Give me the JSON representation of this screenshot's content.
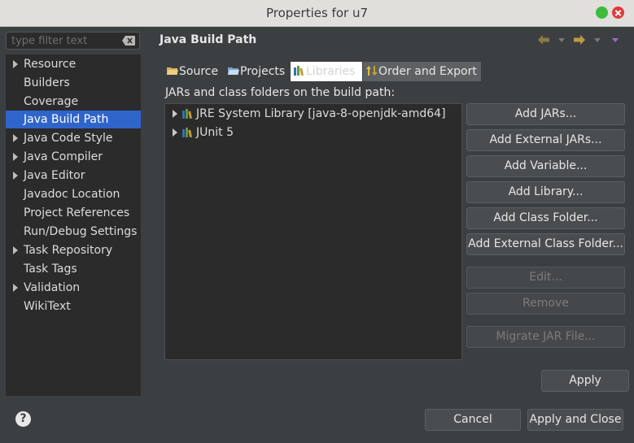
{
  "window": {
    "title": "Properties for u7"
  },
  "filter": {
    "placeholder": "type filter text"
  },
  "nav": {
    "items": [
      {
        "label": "Resource",
        "expandable": true
      },
      {
        "label": "Builders",
        "expandable": false
      },
      {
        "label": "Coverage",
        "expandable": false
      },
      {
        "label": "Java Build Path",
        "expandable": false,
        "selected": true
      },
      {
        "label": "Java Code Style",
        "expandable": true
      },
      {
        "label": "Java Compiler",
        "expandable": true
      },
      {
        "label": "Java Editor",
        "expandable": true
      },
      {
        "label": "Javadoc Location",
        "expandable": false
      },
      {
        "label": "Project References",
        "expandable": false
      },
      {
        "label": "Run/Debug Settings",
        "expandable": false
      },
      {
        "label": "Task Repository",
        "expandable": true
      },
      {
        "label": "Task Tags",
        "expandable": false
      },
      {
        "label": "Validation",
        "expandable": true
      },
      {
        "label": "WikiText",
        "expandable": false
      }
    ]
  },
  "page": {
    "title": "Java Build Path"
  },
  "tabs": [
    {
      "label": "Source",
      "icon": "source-folder-icon"
    },
    {
      "label": "Projects",
      "icon": "projects-icon"
    },
    {
      "label": "Libraries",
      "icon": "libraries-icon",
      "active": true
    },
    {
      "label": "Order and Export",
      "icon": "order-export-icon"
    }
  ],
  "libraries": {
    "section_label": "JARs and class folders on the build path:",
    "entries": [
      {
        "label": "JRE System Library [java-8-openjdk-amd64]"
      },
      {
        "label": "JUnit 5"
      }
    ]
  },
  "buttons": {
    "add_jars": "Add JARs...",
    "add_external_jars": "Add External JARs...",
    "add_variable": "Add Variable...",
    "add_library": "Add Library...",
    "add_class_folder": "Add Class Folder...",
    "add_external_class_folder": "Add External Class Folder...",
    "edit": "Edit...",
    "remove": "Remove",
    "migrate_jar": "Migrate JAR File...",
    "apply": "Apply",
    "cancel": "Cancel",
    "apply_and_close": "Apply and Close"
  },
  "help": {
    "glyph": "?"
  },
  "colors": {
    "selection": "#2f65ca",
    "background": "#3c3f41",
    "panel": "#2b2b2b"
  }
}
